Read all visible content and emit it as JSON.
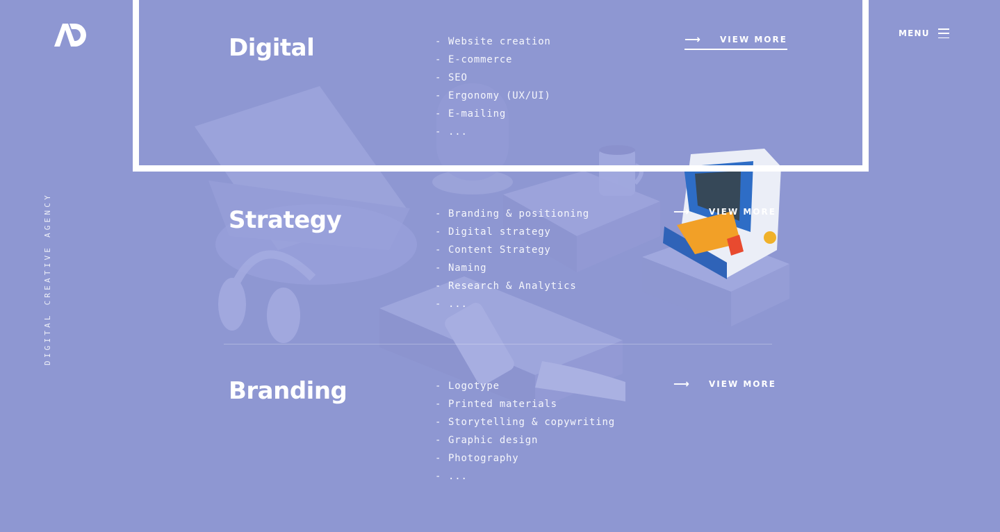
{
  "brand": {
    "logo_text": "AD",
    "tagline": "DIGITAL CREATIVE AGENCY"
  },
  "header": {
    "menu_label": "MENU"
  },
  "services": [
    {
      "title": "Digital",
      "items": [
        "Website creation",
        "E-commerce",
        "SEO",
        "Ergonomy (UX/UI)",
        "E-mailing",
        "..."
      ],
      "cta": "VIEW MORE"
    },
    {
      "title": "Strategy",
      "items": [
        "Branding & positioning",
        "Digital strategy",
        "Content Strategy",
        "Naming",
        "Research & Analytics",
        "..."
      ],
      "cta": "VIEW MORE"
    },
    {
      "title": "Branding",
      "items": [
        "Logotype",
        "Printed materials",
        "Storytelling & copywriting",
        "Graphic design",
        "Photography",
        "..."
      ],
      "cta": "VIEW MORE"
    }
  ],
  "colors": {
    "background": "#8e97d2",
    "foreground": "#ffffff",
    "accent": "#e84a2f"
  },
  "icons": [
    "logo-mark",
    "hamburger-icon",
    "arrow-right-icon"
  ]
}
